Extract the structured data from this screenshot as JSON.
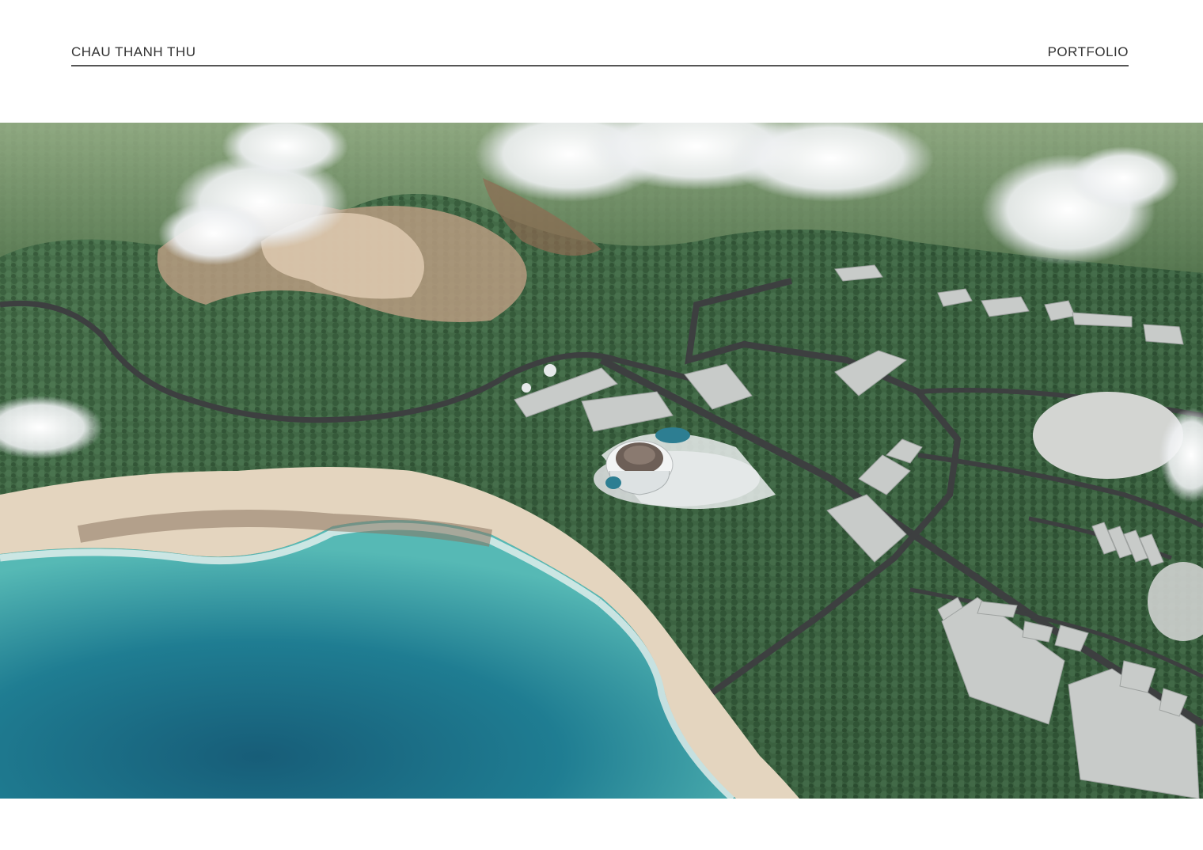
{
  "header": {
    "author": "CHAU THANH THU",
    "section": "PORTFOLIO"
  },
  "render_image": {
    "icon": "aerial-site-render"
  },
  "colors": {
    "rule": "#555555",
    "ocean_deep": "#1f6e86",
    "ocean_shallow": "#3aa6b0",
    "sand": "#e6d6bf",
    "forest": "#355a3a",
    "road": "#3d3f40",
    "building": "#c9ccca",
    "cloud": "#f2f3f4"
  }
}
